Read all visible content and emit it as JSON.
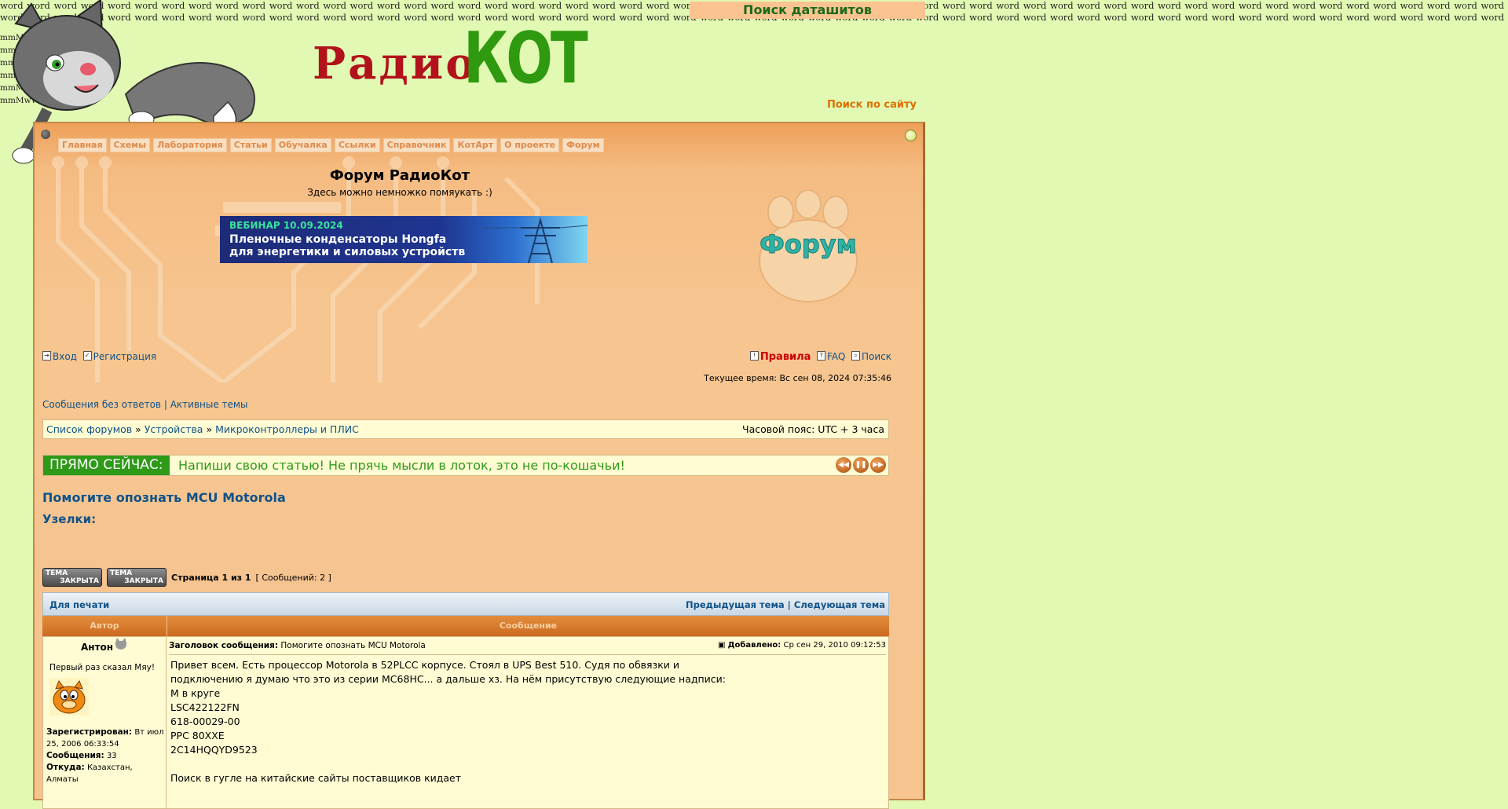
{
  "top": {
    "datasheet_search": "Поиск даташитов",
    "site_search": "Поиск по сайту",
    "filler_word": "word",
    "filler_mm": "mmMwWLliI0fiflO&1"
  },
  "logo": {
    "part1": "Радио",
    "part2": "КОТ"
  },
  "nav": [
    {
      "label": "Главная"
    },
    {
      "label": "Схемы"
    },
    {
      "label": "Лаборатория"
    },
    {
      "label": "Статьи"
    },
    {
      "label": "Обучалка"
    },
    {
      "label": "Ссылки"
    },
    {
      "label": "Справочник"
    },
    {
      "label": "КотАрт"
    },
    {
      "label": "О проекте"
    },
    {
      "label": "Форум"
    }
  ],
  "forum": {
    "title": "Форум РадиоКот",
    "subtitle": "Здесь можно немножко помяукать :)"
  },
  "banner": {
    "line1": "ВЕБИНАР 10.09.2024",
    "line2": "Пленочные конденсаторы Hongfa",
    "line3": "для энергетики и силовых устройств"
  },
  "forum_logo": "Форум",
  "user_links": {
    "login": "Вход",
    "register": "Регистрация",
    "rules": "Правила",
    "faq": "FAQ",
    "search": "Поиск"
  },
  "current_time": "Текущее время: Вс сен 08, 2024 07:35:46",
  "quick_links": {
    "unanswered": "Сообщения без ответов",
    "sep": "|",
    "active": "Активные темы"
  },
  "breadcrumb": {
    "items": [
      "Список форумов",
      "Устройства",
      "Микроконтроллеры и ПЛИС"
    ],
    "sep": "»",
    "timezone": "Часовой пояс: UTC + 3 часа"
  },
  "live": {
    "tag": "ПРЯМО СЕЙЧАС:",
    "message": "Напиши свою статью! Не прячь мысли в лоток, это не по-кошачьи!"
  },
  "topic": {
    "title": "Помогите опознать MCU Motorola",
    "uzelki": "Узелки:"
  },
  "locked": {
    "l1": "ТЕМА",
    "l2": "ЗАКРЫТА",
    "pages": "Страница 1 из 1",
    "count": "[ Сообщений: 2 ]"
  },
  "topbar": {
    "print": "Для печати",
    "prev": "Предыдущая тема",
    "sep": "|",
    "next": "Следующая тема"
  },
  "table": {
    "author_col": "Автор",
    "message_col": "Сообщение"
  },
  "post": {
    "author": "Антон",
    "rank": "Первый раз сказал Мяу!",
    "registered_label": "Зарегистрирован:",
    "registered_value": "Вт июл 25, 2006 06:33:54",
    "messages_label": "Сообщения:",
    "messages_value": "33",
    "from_label": "Откуда:",
    "from_value": "Казахстан, Алматы",
    "subject_label": "Заголовок сообщения:",
    "subject_value": "Помогите опознать MCU Motorola",
    "added_label": "Добавлено:",
    "added_value": "Ср сен 29, 2010 09:12:53",
    "lines": [
      "Привет всем. Есть процессор Motorola в 52PLCC корпусе. Стоял в UPS Best 510. Судя по обвязки и",
      "подключению я думаю что это из серии MC68HC... а дальше хз. На нём присутствую следующие надписи:",
      "М в круге",
      "LSC422122FN",
      "618-00029-00",
      "PPC 80XXE",
      "2C14HQQYD9523",
      "",
      "Поиск в гугле на китайские сайты поставщиков кидает"
    ]
  },
  "colors": {
    "bg": "#e1f9b2",
    "panel": "#f5c48f",
    "accent_green": "#2e9a18",
    "link": "#105289",
    "rules_red": "#cc0000"
  }
}
